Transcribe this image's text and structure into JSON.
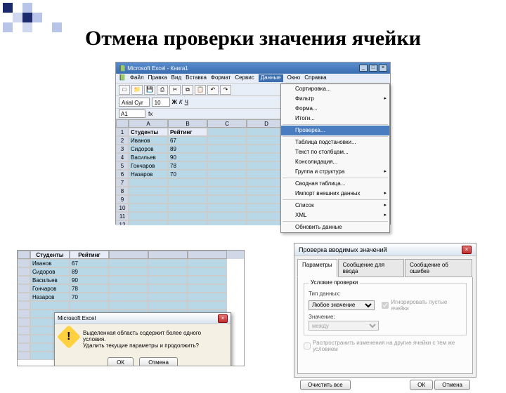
{
  "title": "Отмена проверки значения ячейки",
  "excel": {
    "app_title": "Microsoft Excel - Книга1",
    "menu": [
      "Файл",
      "Правка",
      "Вид",
      "Вставка",
      "Формат",
      "Сервис",
      "Данные",
      "Окно",
      "Справка"
    ],
    "font_name": "Arial Cyr",
    "font_size": "10",
    "namebox": "A1",
    "cols": [
      "A",
      "B",
      "C",
      "D"
    ],
    "headers": [
      "Студенты",
      "Рейтинг"
    ],
    "rows": [
      [
        "Иванов",
        "67"
      ],
      [
        "Сидоров",
        "89"
      ],
      [
        "Васильев",
        "90"
      ],
      [
        "Гончаров",
        "78"
      ],
      [
        "Назаров",
        "70"
      ]
    ],
    "dropdown": [
      {
        "label": "Сортировка...",
        "arr": false
      },
      {
        "label": "Фильтр",
        "arr": true
      },
      {
        "label": "Форма...",
        "arr": false
      },
      {
        "label": "Итоги...",
        "arr": false
      },
      {
        "sep": true
      },
      {
        "label": "Проверка...",
        "arr": false,
        "hl": true
      },
      {
        "sep": true
      },
      {
        "label": "Таблица подстановки...",
        "arr": false
      },
      {
        "label": "Текст по столбцам...",
        "arr": false
      },
      {
        "label": "Консолидация...",
        "arr": false
      },
      {
        "label": "Группа и структура",
        "arr": true
      },
      {
        "sep": true
      },
      {
        "label": "Сводная таблица...",
        "arr": false
      },
      {
        "label": "Импорт внешних данных",
        "arr": true
      },
      {
        "sep": true
      },
      {
        "label": "Список",
        "arr": true
      },
      {
        "label": "XML",
        "arr": true
      },
      {
        "sep": true
      },
      {
        "label": "Обновить данные",
        "arr": false
      }
    ]
  },
  "sheet2": {
    "headers": [
      "Студенты",
      "Рейтинг"
    ],
    "rows": [
      [
        "Иванов",
        "67"
      ],
      [
        "Сидоров",
        "89"
      ],
      [
        "Васильев",
        "90"
      ],
      [
        "Гончаров",
        "78"
      ],
      [
        "Назаров",
        "70"
      ]
    ]
  },
  "alert": {
    "title": "Microsoft Excel",
    "line1": "Выделенная область содержит более одного условия.",
    "line2": "Удалить текущие параметры и продолжить?",
    "ok": "ОК",
    "cancel": "Отмена"
  },
  "dialog": {
    "title": "Проверка вводимых значений",
    "tabs": [
      "Параметры",
      "Сообщение для ввода",
      "Сообщение об ошибке"
    ],
    "group": "Условие проверки",
    "type_label": "Тип данных:",
    "type_value": "Любое значение",
    "ignore": "Игнорировать пустые ячейки",
    "value_label": "Значение:",
    "value_value": "между",
    "spread": "Распространить изменения на другие ячейки с тем же условием",
    "clear": "Очистить все",
    "ok": "ОК",
    "cancel": "Отмена"
  }
}
